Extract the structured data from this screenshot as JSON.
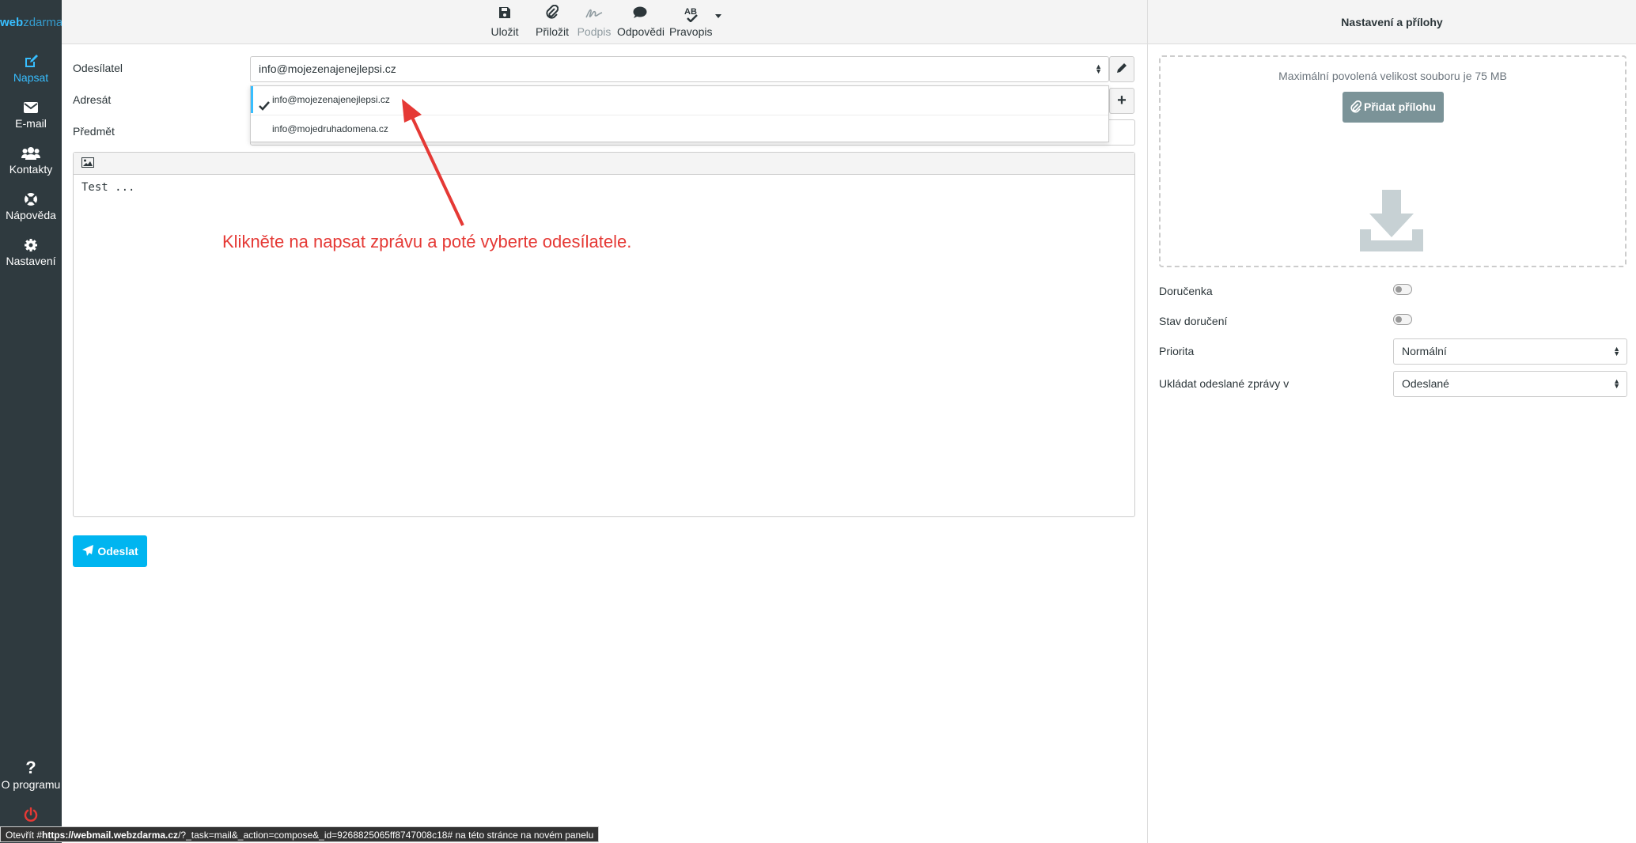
{
  "logo": {
    "part1": "web",
    "part2": "zdarma"
  },
  "nav": {
    "items": [
      {
        "label": "Napsat",
        "icon": "pencil-square-icon",
        "active": true
      },
      {
        "label": "E-mail",
        "icon": "envelope-icon"
      },
      {
        "label": "Kontakty",
        "icon": "users-icon"
      },
      {
        "label": "Nápověda",
        "icon": "lifebuoy-icon"
      },
      {
        "label": "Nastavení",
        "icon": "gear-icon"
      }
    ],
    "about": "O programu",
    "logout_icon": "power-icon"
  },
  "toolbar": {
    "save": "Uložit",
    "attach": "Přiložit",
    "signature": "Podpis",
    "responses": "Odpovědi",
    "spell": "Pravopis",
    "spell_icon_text": "AB"
  },
  "form": {
    "sender_label": "Odesílatel",
    "sender_value": "info@mojezenajenejlepsi.cz",
    "recipient_label": "Adresát",
    "subject_label": "Předmět",
    "sender_options": [
      {
        "value": "info@mojezenajenejlepsi.cz",
        "selected": true
      },
      {
        "value": "info@mojedruhadomena.cz",
        "selected": false
      }
    ],
    "body": "Test ...",
    "send": "Odeslat"
  },
  "annotation": "Klikněte na napsat zprávu a poté vyberte odesílatele.",
  "right_panel": {
    "title": "Nastavení a přílohy",
    "max_size": "Maximální povolená velikost souboru je 75 MB",
    "add_attachment": "Přidat přílohu",
    "receipt_label": "Doručenka",
    "dsn_label": "Stav doručení",
    "priority_label": "Priorita",
    "priority_value": "Normální",
    "save_sent_label": "Ukládat odeslané zprávy v",
    "save_sent_value": "Odeslané"
  },
  "statusbar": {
    "prefix": "Otevřít #",
    "url_bold": "https://webmail.webzdarma.cz",
    "url_rest": "/?_task=mail&_action=compose&_id=9268825065ff8747008c18#",
    "suffix": " na této stránce na novém panelu"
  },
  "colors": {
    "accent": "#37beff",
    "nav_bg": "#2f3a3f",
    "annotation": "#e53935",
    "send_button": "#00b5f0"
  }
}
